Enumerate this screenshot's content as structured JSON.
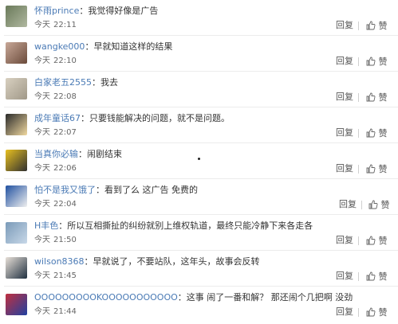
{
  "comments": [
    {
      "username": "怀雨prince",
      "separator": "：",
      "text": "我觉得好像是广告",
      "day": "今天",
      "time": "22:11",
      "reply_label": "回复",
      "like_label": "赞",
      "avatar_colors": [
        "#6a7a5a",
        "#b0b8a0"
      ]
    },
    {
      "username": "wangke000",
      "separator": "：",
      "text": "早就知道这样的结果",
      "day": "今天",
      "time": "22:10",
      "reply_label": "回复",
      "like_label": "赞",
      "avatar_colors": [
        "#c8a898",
        "#6a4a3a"
      ]
    },
    {
      "username": "白家老五2555",
      "separator": "：",
      "text": "我去",
      "day": "今天",
      "time": "22:08",
      "reply_label": "回复",
      "like_label": "赞",
      "avatar_colors": [
        "#d8d0c0",
        "#a09888"
      ]
    },
    {
      "username": "成年童话67",
      "separator": "：",
      "text": "只要钱能解决的问题，就不是问题。",
      "day": "今天",
      "time": "22:07",
      "reply_label": "回复",
      "like_label": "赞",
      "avatar_colors": [
        "#2a2a2a",
        "#f0d8a0"
      ]
    },
    {
      "username": "当真你必输",
      "separator": "：",
      "text": "闹剧结束",
      "day": "今天",
      "time": "22:06",
      "reply_label": "回复",
      "like_label": "赞",
      "avatar_colors": [
        "#e8c020",
        "#303030"
      ]
    },
    {
      "username": "怕不是我又饿了",
      "separator": "：",
      "text": "看到了么 这广告 免费的",
      "day": "今天",
      "time": "22:04",
      "reply_label": "回复",
      "like_label": "赞",
      "avatar_colors": [
        "#2050a0",
        "#f0f0f0"
      ]
    },
    {
      "username": "H丰色",
      "separator": "：",
      "text": "所以互相撕扯的纠纷就别上维权轨道，最终只能冷静下来各走各",
      "day": "今天",
      "time": "21:50",
      "reply_label": "回复",
      "like_label": "赞",
      "avatar_colors": [
        "#7a9ab8",
        "#c8d8e8"
      ]
    },
    {
      "username": "wilson8368",
      "separator": "：",
      "text": "早就说了，不要站队，这年头，故事会反转",
      "day": "今天",
      "time": "21:45",
      "reply_label": "回复",
      "like_label": "赞",
      "avatar_colors": [
        "#e8e0d8",
        "#203040"
      ]
    },
    {
      "username": "OOOOOOOOOKOOOOOOOOOOO",
      "separator": "：",
      "text": "这事 闹了一番和解？ 那还闹个几把啊 没劲",
      "day": "今天",
      "time": "21:44",
      "reply_label": "回复",
      "like_label": "赞",
      "avatar_colors": [
        "#c03040",
        "#2040a0"
      ]
    }
  ]
}
